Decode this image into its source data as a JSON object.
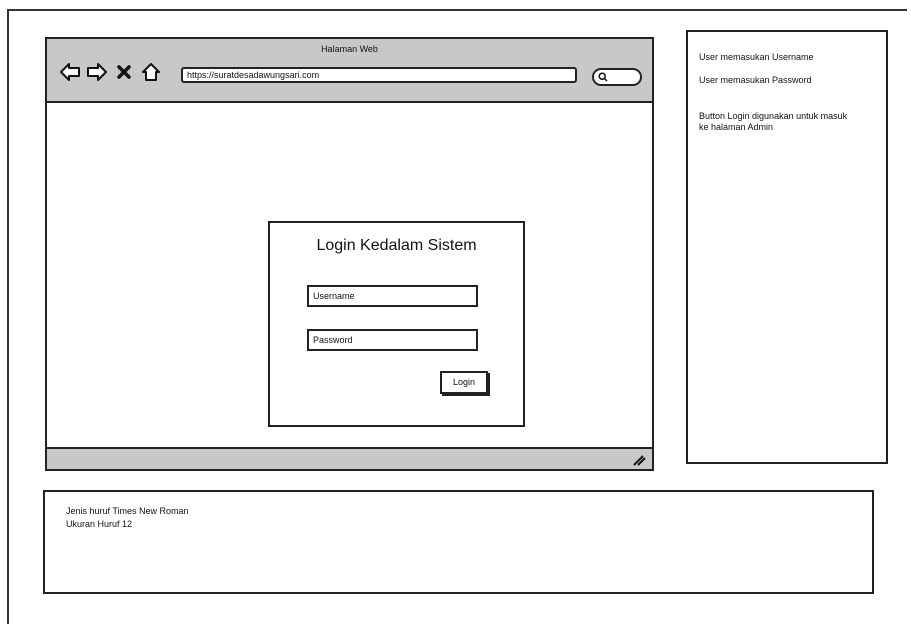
{
  "browser": {
    "title": "Halaman Web",
    "url": "https://suratdesadawungsari.com",
    "nav_icons": [
      "back-arrow-icon",
      "forward-arrow-icon",
      "close-x-icon",
      "home-icon"
    ],
    "search_icon": "search-icon"
  },
  "login": {
    "title": "Login Kedalam Sistem",
    "username_placeholder": "Username",
    "password_placeholder": "Password",
    "login_label": "Login"
  },
  "notes": {
    "items": [
      "User memasukan Username",
      "User memasukan Password",
      "Button Login digunakan untuk  masuk ke halaman Admin"
    ]
  },
  "font_notes": {
    "lines": [
      "Jenis huruf Times New Roman",
      "Ukuran Huruf 12"
    ]
  }
}
